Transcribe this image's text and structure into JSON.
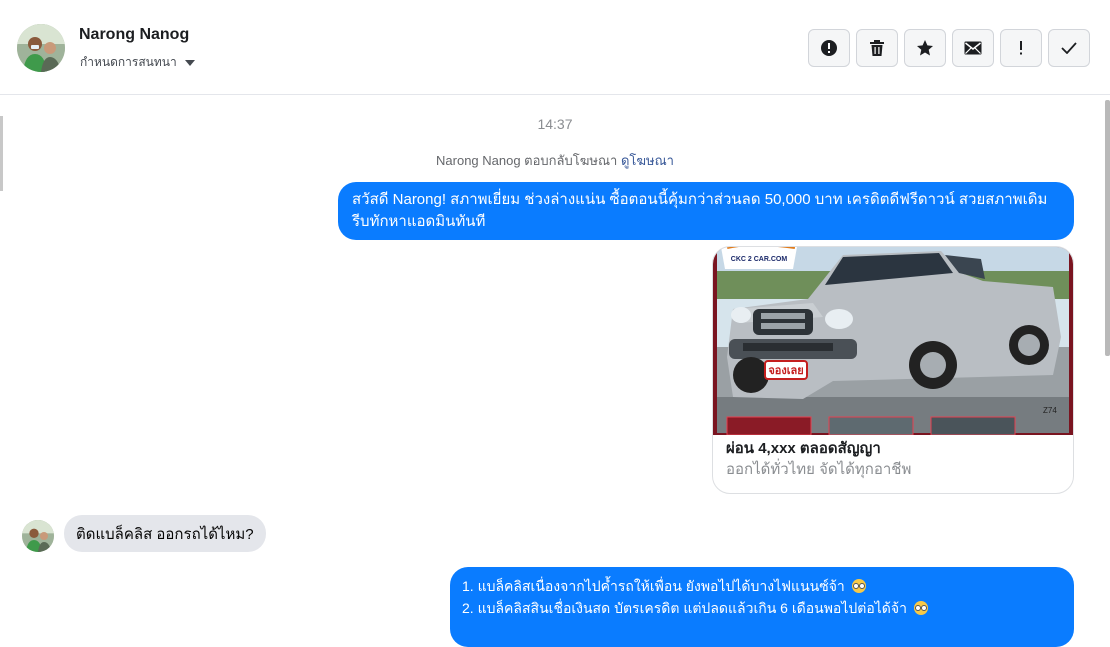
{
  "header": {
    "name": "Narong Nanog",
    "conversation_settings": "กำหนดการสนทนา"
  },
  "actions": [
    {
      "icon": "alert-circle-icon"
    },
    {
      "icon": "trash-icon"
    },
    {
      "icon": "star-icon"
    },
    {
      "icon": "envelope-icon"
    },
    {
      "icon": "exclamation-icon"
    },
    {
      "icon": "checkmark-icon"
    }
  ],
  "conversation": {
    "timestamp": "14:37",
    "reply_note_prefix": "Narong Nanog ตอบกลับโฆษณา",
    "reply_note_link": "ดูโฆษณา",
    "message1": "สวัสดี Narong!  สภาพเยี่ยม ช่วงล่างแน่น  ซื้อตอนนี้คุ้มกว่าส่วนลด 50,000 บาท เครดิตดีฟรีดาวน์  สวยสภาพเดิม รีบทักหาแอดมินทันที",
    "ad_card": {
      "brand": "CKC 2 CAR.COM",
      "badge": "จองเลย",
      "code": "Z74",
      "title": "ผ่อน 4,xxx ตลอดสัญญา",
      "subtitle": "ออกได้ทั่วไทย จัดได้ทุกอาชีพ"
    },
    "incoming_message": "ติดแบล็คลิส ออกรถได้ไหม?",
    "message2_line1": "1. แบล็คลิสเนื่องจากไปค้ำรถให้เพื่อน ยังพอไปได้บางไฟแนนซ์จ้า",
    "message2_line2": "2. แบล็คลิสสินเชื่อเงินสด บัตรเครดิต แต่ปลดแล้วเกิน 6 เดือนพอไปต่อได้จ้า"
  },
  "colors": {
    "outgoing_bubble": "#0a7cff",
    "incoming_bubble": "#e4e6eb",
    "link": "#385898"
  }
}
